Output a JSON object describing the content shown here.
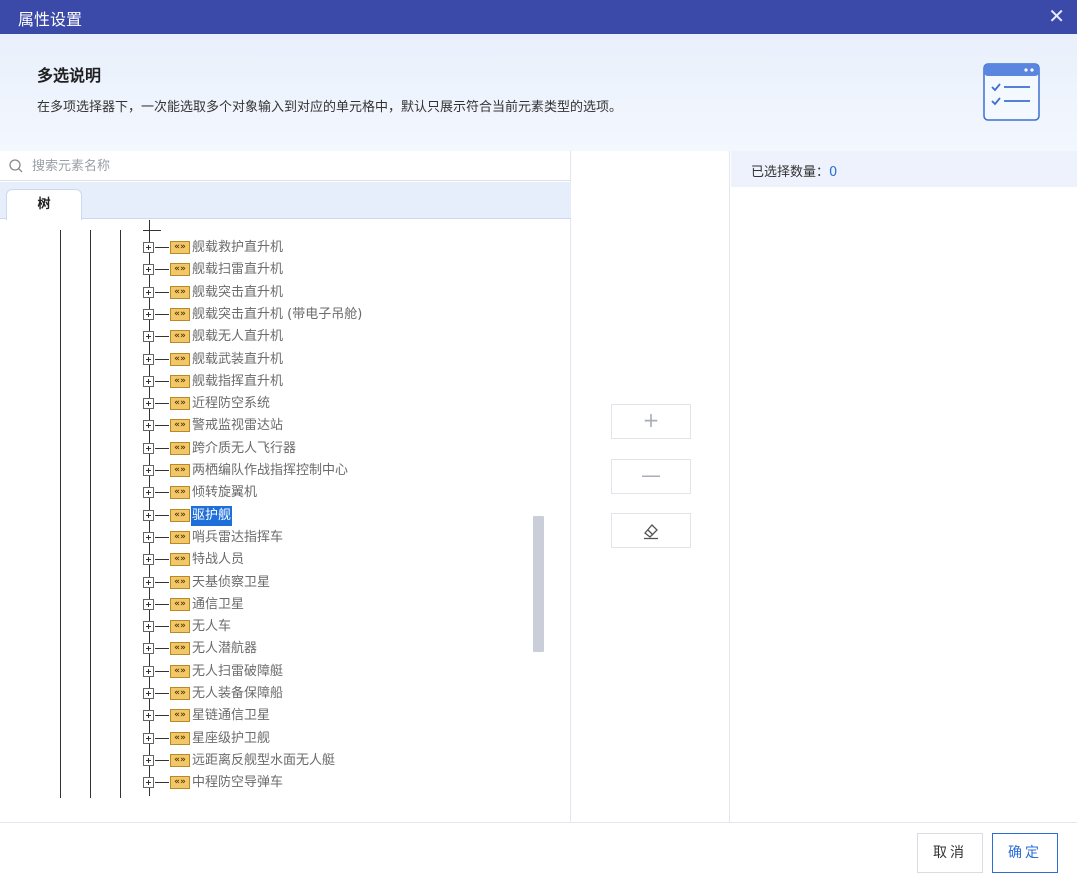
{
  "window": {
    "title": "属性设置",
    "close_glyph": "✕"
  },
  "banner": {
    "title": "多选说明",
    "description": "在多项选择器下，一次能选取多个对象输入到对应的单元格中，默认只展示符合当前元素类型的选项。",
    "icon": "checklist-icon"
  },
  "search": {
    "placeholder": "搜索元素名称",
    "value": ""
  },
  "tabs": [
    {
      "label": "树",
      "active": true
    }
  ],
  "tree": {
    "icon_text": "«»",
    "items": [
      {
        "label": "舰载救护直升机"
      },
      {
        "label": "舰载扫雷直升机"
      },
      {
        "label": "舰载突击直升机"
      },
      {
        "label": "舰载突击直升机 (带电子吊舱)"
      },
      {
        "label": "舰载无人直升机"
      },
      {
        "label": "舰载武装直升机"
      },
      {
        "label": "舰载指挥直升机"
      },
      {
        "label": "近程防空系统"
      },
      {
        "label": "警戒监视雷达站"
      },
      {
        "label": "跨介质无人飞行器"
      },
      {
        "label": "两栖编队作战指挥控制中心"
      },
      {
        "label": "倾转旋翼机"
      },
      {
        "label": "驱护舰",
        "selected": true
      },
      {
        "label": "哨兵雷达指挥车"
      },
      {
        "label": "特战人员"
      },
      {
        "label": "天基侦察卫星"
      },
      {
        "label": "通信卫星"
      },
      {
        "label": "无人车"
      },
      {
        "label": "无人潜航器"
      },
      {
        "label": "无人扫雷破障艇"
      },
      {
        "label": "无人装备保障船"
      },
      {
        "label": "星链通信卫星"
      },
      {
        "label": "星座级护卫舰"
      },
      {
        "label": "远距离反舰型水面无人艇"
      },
      {
        "label": "中程防空导弹车"
      }
    ]
  },
  "transfer_buttons": {
    "add": "+",
    "remove": "—",
    "clear_icon": "eraser-icon"
  },
  "selected_panel": {
    "label": "已选择数量：",
    "count": "0"
  },
  "footer": {
    "cancel": "取消",
    "ok": "确定"
  },
  "colors": {
    "titlebar": "#3b4aa8",
    "accent": "#2a6dd9",
    "selection": "#1f6fdb"
  }
}
